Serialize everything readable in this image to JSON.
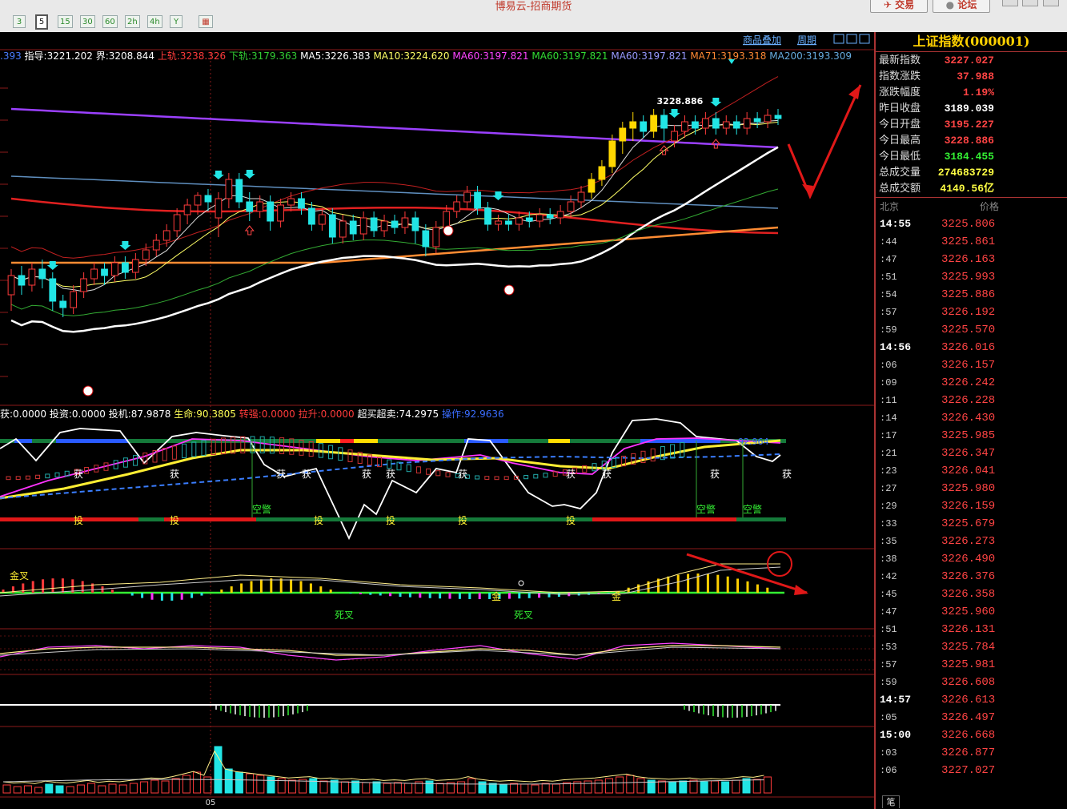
{
  "window": {
    "title": "博易云-招商期货",
    "trade_label": "交易",
    "forum_label": "论坛"
  },
  "toolbar": {
    "periods": [
      "3",
      "5",
      "15",
      "30",
      "60",
      "2h",
      "4h",
      "Y"
    ],
    "selected_period": "5"
  },
  "chart_header": {
    "overlay_label": "商品叠加",
    "period_label": "周期"
  },
  "legends": {
    "main": [
      {
        "text": ".393",
        "color": "#4a7dff"
      },
      {
        "text": "指导:3221.202",
        "color": "#ffffff"
      },
      {
        "text": "界:3208.844",
        "color": "#ffffff"
      },
      {
        "text": "上轨:3238.326",
        "color": "#ff3b3b"
      },
      {
        "text": "下轨:3179.363",
        "color": "#33cc33"
      },
      {
        "text": "MA5:3226.383",
        "color": "#ffffff"
      },
      {
        "text": "MA10:3224.620",
        "color": "#ffff66"
      },
      {
        "text": "MA60:3197.821",
        "color": "#ff44ff"
      },
      {
        "text": "MA60:3197.821",
        "color": "#33dd33"
      },
      {
        "text": "MA60:3197.821",
        "color": "#9999ff"
      },
      {
        "text": "MA71:3193.318",
        "color": "#ff8833"
      },
      {
        "text": "MA200:3193.309",
        "color": "#66aadd"
      }
    ],
    "indicator": [
      {
        "text": "获:0.0000",
        "color": "#ffffff"
      },
      {
        "text": "投资:0.0000",
        "color": "#ffffff"
      },
      {
        "text": "投机:87.9878",
        "color": "#ffffff"
      },
      {
        "text": "生命:90.3805",
        "color": "#ffff55"
      },
      {
        "text": "转强:0.0000",
        "color": "#ff3b3b"
      },
      {
        "text": "拉升:0.0000",
        "color": "#ff3b3b"
      },
      {
        "text": "超买超卖:74.2975",
        "color": "#ffffff"
      },
      {
        "text": "操作:92.9636",
        "color": "#3a6dff"
      }
    ]
  },
  "annotations": {
    "high_price": "3228.886",
    "indicator_value": "92.964",
    "huo": "获",
    "tou": "投",
    "kongjing": "空警",
    "jinca": "金叉",
    "sicha": "死叉",
    "jin": "金",
    "date_tick": "05"
  },
  "quote": {
    "title": "上证指数(000001)",
    "stats": [
      {
        "label": "最新指数",
        "value": "3227.027",
        "color": "#ff4444"
      },
      {
        "label": "指数涨跌",
        "value": "37.988",
        "color": "#ff4444"
      },
      {
        "label": "涨跌幅度",
        "value": "1.19%",
        "color": "#ff4444"
      },
      {
        "label": "昨日收盘",
        "value": "3189.039",
        "color": "#ffffff"
      },
      {
        "label": "今日开盘",
        "value": "3195.227",
        "color": "#ff4444"
      },
      {
        "label": "今日最高",
        "value": "3228.886",
        "color": "#ff4444"
      },
      {
        "label": "今日最低",
        "value": "3184.455",
        "color": "#33ee33"
      },
      {
        "label": "总成交量",
        "value": "274683729",
        "color": "#ffff44"
      },
      {
        "label": "总成交额",
        "value": "4140.56亿",
        "color": "#ffff44"
      }
    ],
    "ticks_header_left": "北京",
    "ticks_header_right": "价格",
    "ticks": [
      {
        "time": "14:55",
        "price": "3225.806",
        "big": true
      },
      {
        "time": ":44",
        "price": "3225.861"
      },
      {
        "time": ":47",
        "price": "3226.163"
      },
      {
        "time": ":51",
        "price": "3225.993"
      },
      {
        "time": ":54",
        "price": "3225.886"
      },
      {
        "time": ":57",
        "price": "3226.192"
      },
      {
        "time": ":59",
        "price": "3225.570"
      },
      {
        "time": "14:56",
        "price": "3226.016",
        "big": true
      },
      {
        "time": ":06",
        "price": "3226.157"
      },
      {
        "time": ":09",
        "price": "3226.242"
      },
      {
        "time": ":11",
        "price": "3226.228"
      },
      {
        "time": ":14",
        "price": "3226.430"
      },
      {
        "time": ":17",
        "price": "3225.985"
      },
      {
        "time": ":21",
        "price": "3226.347"
      },
      {
        "time": ":23",
        "price": "3226.041"
      },
      {
        "time": ":27",
        "price": "3225.980"
      },
      {
        "time": ":29",
        "price": "3226.159"
      },
      {
        "time": ":33",
        "price": "3225.679"
      },
      {
        "time": ":35",
        "price": "3226.273"
      },
      {
        "time": ":38",
        "price": "3226.490"
      },
      {
        "time": ":42",
        "price": "3226.376"
      },
      {
        "time": ":45",
        "price": "3226.358"
      },
      {
        "time": ":47",
        "price": "3225.960"
      },
      {
        "time": ":51",
        "price": "3226.131"
      },
      {
        "time": ":53",
        "price": "3225.784"
      },
      {
        "time": ":57",
        "price": "3225.981"
      },
      {
        "time": ":59",
        "price": "3226.608"
      },
      {
        "time": "14:57",
        "price": "3226.613",
        "big": true
      },
      {
        "time": ":05",
        "price": "3226.497"
      },
      {
        "time": "15:00",
        "price": "3226.668",
        "big": true
      },
      {
        "time": ":03",
        "price": "3226.877"
      },
      {
        "time": ":06",
        "price": "3227.027"
      }
    ],
    "tab_label": "笔"
  },
  "chart_data": {
    "type": "candlestick",
    "ylim": [
      3150,
      3245
    ],
    "candles": [
      [
        3178,
        3184,
        3173,
        3186
      ],
      [
        3184,
        3181,
        3178,
        3187
      ],
      [
        3181,
        3186,
        3179,
        3188
      ],
      [
        3186,
        3183,
        3180,
        3189
      ],
      [
        3183,
        3176,
        3173,
        3185
      ],
      [
        3176,
        3174,
        3171,
        3178
      ],
      [
        3174,
        3179,
        3172,
        3181
      ],
      [
        3179,
        3183,
        3177,
        3185
      ],
      [
        3183,
        3186,
        3181,
        3188
      ],
      [
        3186,
        3184,
        3181,
        3188
      ],
      [
        3184,
        3188,
        3182,
        3190
      ],
      [
        3188,
        3185,
        3183,
        3190
      ],
      [
        3185,
        3189,
        3183,
        3191
      ],
      [
        3189,
        3192,
        3187,
        3194
      ],
      [
        3192,
        3195,
        3190,
        3197
      ],
      [
        3195,
        3198,
        3193,
        3200
      ],
      [
        3198,
        3203,
        3196,
        3205
      ],
      [
        3203,
        3206,
        3200,
        3208
      ],
      [
        3206,
        3209,
        3203,
        3210
      ],
      [
        3209,
        3207,
        3204,
        3211
      ],
      [
        3202,
        3208,
        3196,
        3210
      ],
      [
        3208,
        3214,
        3205,
        3216
      ],
      [
        3214,
        3207,
        3205,
        3216
      ],
      [
        3207,
        3204,
        3201,
        3210
      ],
      [
        3204,
        3207,
        3202,
        3209
      ],
      [
        3207,
        3201,
        3198,
        3209
      ],
      [
        3201,
        3206,
        3199,
        3208
      ],
      [
        3206,
        3208,
        3204,
        3210
      ],
      [
        3208,
        3205,
        3203,
        3210
      ],
      [
        3205,
        3200,
        3198,
        3207
      ],
      [
        3200,
        3203,
        3198,
        3205
      ],
      [
        3203,
        3196,
        3194,
        3205
      ],
      [
        3196,
        3201,
        3194,
        3203
      ],
      [
        3201,
        3197,
        3195,
        3203
      ],
      [
        3197,
        3202,
        3195,
        3204
      ],
      [
        3202,
        3198,
        3196,
        3204
      ],
      [
        3198,
        3201,
        3196,
        3203
      ],
      [
        3201,
        3199,
        3197,
        3203
      ],
      [
        3199,
        3202,
        3197,
        3204
      ],
      [
        3202,
        3198,
        3194,
        3204
      ],
      [
        3198,
        3193,
        3190,
        3200
      ],
      [
        3193,
        3199,
        3191,
        3201
      ],
      [
        3199,
        3204,
        3197,
        3206
      ],
      [
        3204,
        3207,
        3202,
        3209
      ],
      [
        3207,
        3210,
        3205,
        3212
      ],
      [
        3210,
        3205,
        3203,
        3212
      ],
      [
        3205,
        3200,
        3198,
        3207
      ],
      [
        3200,
        3201,
        3198,
        3203
      ],
      [
        3201,
        3200,
        3198,
        3203
      ],
      [
        3200,
        3202,
        3198,
        3204
      ],
      [
        3202,
        3201,
        3199,
        3204
      ],
      [
        3201,
        3203,
        3199,
        3205
      ],
      [
        3203,
        3202,
        3200,
        3205
      ],
      [
        3202,
        3204,
        3200,
        3206
      ],
      [
        3204,
        3207,
        3202,
        3209
      ],
      [
        3207,
        3210,
        3205,
        3212
      ],
      [
        3210,
        3214,
        3208,
        3216
      ],
      [
        3214,
        3218,
        3212,
        3220
      ],
      [
        3218,
        3226,
        3216,
        3228
      ],
      [
        3226,
        3230,
        3222,
        3232
      ],
      [
        3230,
        3232,
        3226,
        3235
      ],
      [
        3232,
        3229,
        3227,
        3234
      ],
      [
        3229,
        3234,
        3227,
        3236
      ],
      [
        3234,
        3230,
        3226,
        3236
      ],
      [
        3226,
        3229,
        3224,
        3231
      ],
      [
        3229,
        3232,
        3227,
        3234
      ],
      [
        3232,
        3230,
        3228,
        3234
      ],
      [
        3230,
        3233,
        3228,
        3235
      ],
      [
        3233,
        3230,
        3228,
        3235
      ],
      [
        3230,
        3232,
        3228,
        3234
      ],
      [
        3232,
        3230,
        3228,
        3234
      ],
      [
        3230,
        3233,
        3228,
        3235
      ],
      [
        3233,
        3232,
        3230,
        3235
      ],
      [
        3232,
        3234,
        3230,
        3236
      ],
      [
        3234,
        3233,
        3231,
        3236
      ]
    ]
  }
}
